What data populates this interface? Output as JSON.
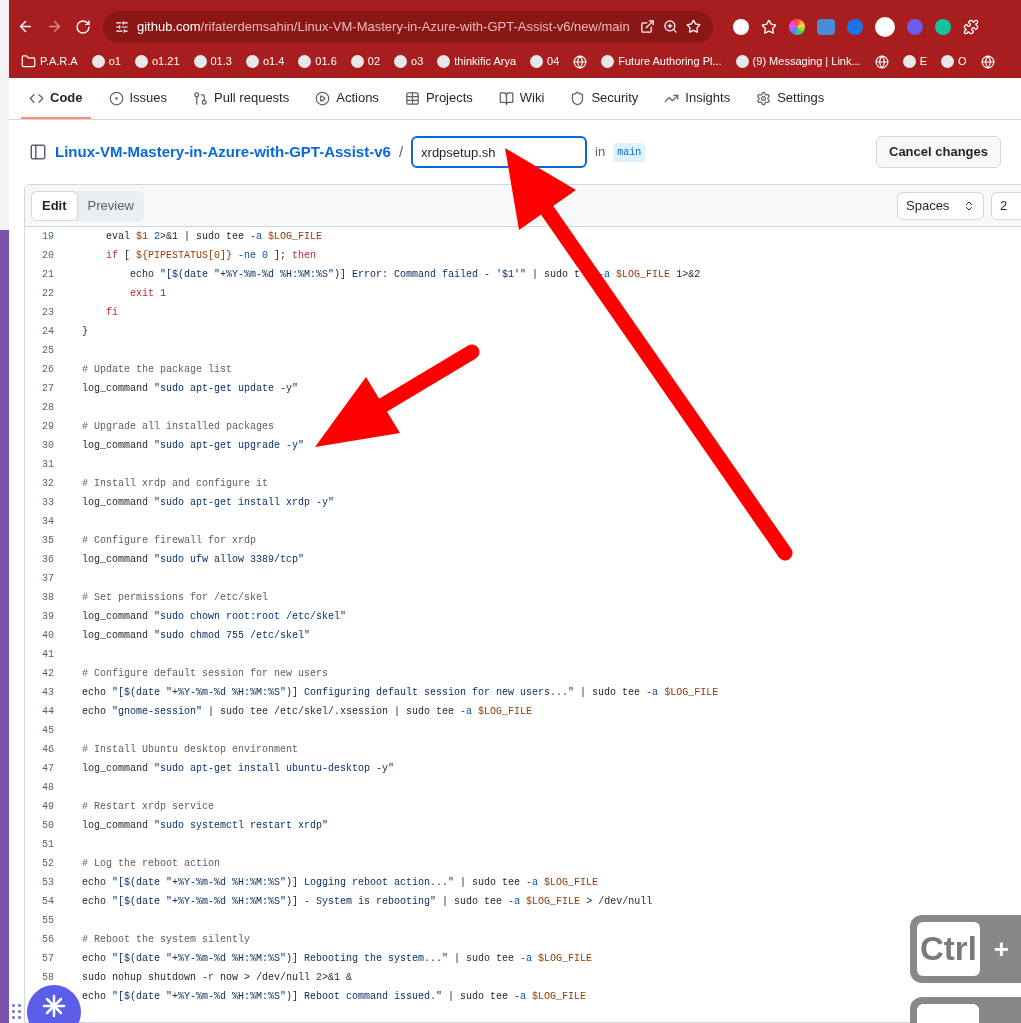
{
  "browser": {
    "url_host": "github.com",
    "url_path": "/rifaterdemsahin/Linux-VM-Mastery-in-Azure-with-GPT-Assist-v6/new/main",
    "bookmarks": [
      {
        "kind": "folder",
        "label": "P.A.R.A"
      },
      {
        "kind": "link",
        "label": "o1"
      },
      {
        "kind": "link",
        "label": "o1.21"
      },
      {
        "kind": "link",
        "label": "01.3"
      },
      {
        "kind": "link",
        "label": "o1.4"
      },
      {
        "kind": "link",
        "label": "01.6"
      },
      {
        "kind": "link",
        "label": "02"
      },
      {
        "kind": "link",
        "label": "o3"
      },
      {
        "kind": "link",
        "label": "thinkific Arya"
      },
      {
        "kind": "link",
        "label": "04"
      },
      {
        "kind": "icon"
      },
      {
        "kind": "link",
        "label": "Future Authoring Pl..."
      },
      {
        "kind": "link",
        "label": "(9) Messaging | Link..."
      },
      {
        "kind": "icon"
      },
      {
        "kind": "link",
        "label": "E"
      },
      {
        "kind": "link",
        "label": "O"
      },
      {
        "kind": "icon"
      }
    ]
  },
  "repo_nav": [
    {
      "label": "Code",
      "selected": true
    },
    {
      "label": "Issues",
      "selected": false
    },
    {
      "label": "Pull requests",
      "selected": false
    },
    {
      "label": "Actions",
      "selected": false
    },
    {
      "label": "Projects",
      "selected": false
    },
    {
      "label": "Wiki",
      "selected": false
    },
    {
      "label": "Security",
      "selected": false
    },
    {
      "label": "Insights",
      "selected": false
    },
    {
      "label": "Settings",
      "selected": false
    }
  ],
  "breadcrumb": {
    "repo": "Linux-VM-Mastery-in-Azure-with-GPT-Assist-v6",
    "separator": "/",
    "filename": "xrdpsetup.sh",
    "in_label": "in",
    "branch": "main",
    "cancel_button": "Cancel changes"
  },
  "editor": {
    "modes": [
      {
        "label": "Edit",
        "selected": true
      },
      {
        "label": "Preview",
        "selected": false
      }
    ],
    "indent_mode": "Spaces",
    "indent_size": "2",
    "lines": [
      {
        "number": "19",
        "tokens": [
          {
            "kind": "plain",
            "text": "    eval "
          },
          {
            "kind": "var",
            "text": "$1"
          },
          {
            "kind": "num",
            "text": " 2"
          },
          {
            "kind": "plain",
            "text": ">&1 | sudo tee "
          },
          {
            "kind": "flag",
            "text": "-a "
          },
          {
            "kind": "var",
            "text": "$LOG_FILE"
          }
        ]
      },
      {
        "number": "20",
        "tokens": [
          {
            "kind": "kw",
            "text": "    if"
          },
          {
            "kind": "plain",
            "text": " [ "
          },
          {
            "kind": "var",
            "text": "${PIPESTATUS[0]}"
          },
          {
            "kind": "flag",
            "text": " -ne "
          },
          {
            "kind": "num",
            "text": "0"
          },
          {
            "kind": "plain",
            "text": " ]; "
          },
          {
            "kind": "kw",
            "text": "then"
          }
        ]
      },
      {
        "number": "21",
        "tokens": [
          {
            "kind": "plain",
            "text": "        echo "
          },
          {
            "kind": "str",
            "text": "\"[$(date \"+%Y-%m-%d %H:%M:%S\")] Error: Command failed - '$1'\""
          },
          {
            "kind": "plain",
            "text": " | sudo t"
          },
          {
            "kind": "covered"
          },
          {
            "kind": "flag",
            "text": "-a "
          },
          {
            "kind": "var",
            "text": "$LOG_FILE"
          },
          {
            "kind": "plain",
            "text": " 1>&2"
          }
        ]
      },
      {
        "number": "22",
        "tokens": [
          {
            "kind": "kw",
            "text": "        exit"
          },
          {
            "kind": "num",
            "text": " 1"
          }
        ]
      },
      {
        "number": "23",
        "tokens": [
          {
            "kind": "kw",
            "text": "    fi"
          }
        ]
      },
      {
        "number": "24",
        "tokens": [
          {
            "kind": "plain",
            "text": "}"
          }
        ]
      },
      {
        "number": "25"
      },
      {
        "number": "26",
        "tokens": [
          {
            "kind": "comment",
            "text": "# Update the package list"
          }
        ]
      },
      {
        "number": "27",
        "tokens": [
          {
            "kind": "plain",
            "text": "log_command "
          },
          {
            "kind": "str",
            "text": "\"sudo apt-get update -y\""
          }
        ]
      },
      {
        "number": "28"
      },
      {
        "number": "29",
        "tokens": [
          {
            "kind": "comment",
            "text": "# Upgrade all installed packages"
          }
        ]
      },
      {
        "number": "30",
        "tokens": [
          {
            "kind": "plain",
            "text": "log_command "
          },
          {
            "kind": "str",
            "text": "\"sudo apt-get upgrade -y\""
          }
        ]
      },
      {
        "number": "31"
      },
      {
        "number": "32",
        "tokens": [
          {
            "kind": "comment",
            "text": "# Install xrdp and configure it"
          }
        ]
      },
      {
        "number": "33",
        "tokens": [
          {
            "kind": "plain",
            "text": "log_command "
          },
          {
            "kind": "str",
            "text": "\"sudo apt-get install xrdp -y\""
          }
        ]
      },
      {
        "number": "34"
      },
      {
        "number": "35",
        "tokens": [
          {
            "kind": "comment",
            "text": "# Configure firewall for xrdp"
          }
        ]
      },
      {
        "number": "36",
        "tokens": [
          {
            "kind": "plain",
            "text": "log_command "
          },
          {
            "kind": "str",
            "text": "\"sudo ufw allow 3389/tcp\""
          }
        ]
      },
      {
        "number": "37"
      },
      {
        "number": "38",
        "tokens": [
          {
            "kind": "comment",
            "text": "# Set permissions for /etc/skel"
          }
        ]
      },
      {
        "number": "39",
        "tokens": [
          {
            "kind": "plain",
            "text": "log_command "
          },
          {
            "kind": "str",
            "text": "\"sudo chown root:root /etc/skel\""
          }
        ]
      },
      {
        "number": "40",
        "tokens": [
          {
            "kind": "plain",
            "text": "log_command "
          },
          {
            "kind": "str",
            "text": "\"sudo chmod 755 /etc/skel\""
          }
        ]
      },
      {
        "number": "41"
      },
      {
        "number": "42",
        "tokens": [
          {
            "kind": "comment",
            "text": "# Configure default session for new users"
          }
        ]
      },
      {
        "number": "43",
        "tokens": [
          {
            "kind": "plain",
            "text": "echo "
          },
          {
            "kind": "str",
            "text": "\"[$(date \"+%Y-%m-%d %H:%M:%S\")] Configuring default session for new users...\""
          },
          {
            "kind": "plain",
            "text": " | sudo tee "
          },
          {
            "kind": "flag",
            "text": "-a "
          },
          {
            "kind": "var",
            "text": "$LOG_FILE"
          }
        ]
      },
      {
        "number": "44",
        "tokens": [
          {
            "kind": "plain",
            "text": "echo "
          },
          {
            "kind": "str",
            "text": "\"gnome-session\""
          },
          {
            "kind": "plain",
            "text": " | sudo tee /etc/skel/.xsession | sudo tee "
          },
          {
            "kind": "flag",
            "text": "-a "
          },
          {
            "kind": "var",
            "text": "$LOG_FILE"
          }
        ]
      },
      {
        "number": "45"
      },
      {
        "number": "46",
        "tokens": [
          {
            "kind": "comment",
            "text": "# Install Ubuntu desktop environment"
          }
        ]
      },
      {
        "number": "47",
        "tokens": [
          {
            "kind": "plain",
            "text": "log_command "
          },
          {
            "kind": "str",
            "text": "\"sudo apt-get install ubuntu-desktop -y\""
          }
        ]
      },
      {
        "number": "48"
      },
      {
        "number": "49",
        "tokens": [
          {
            "kind": "comment",
            "text": "# Restart xrdp service"
          }
        ]
      },
      {
        "number": "50",
        "tokens": [
          {
            "kind": "plain",
            "text": "log_command "
          },
          {
            "kind": "str",
            "text": "\"sudo systemctl restart xrdp\""
          }
        ]
      },
      {
        "number": "51"
      },
      {
        "number": "52",
        "tokens": [
          {
            "kind": "comment",
            "text": "# Log the reboot action"
          }
        ]
      },
      {
        "number": "53",
        "tokens": [
          {
            "kind": "plain",
            "text": "echo "
          },
          {
            "kind": "str",
            "text": "\"[$(date \"+%Y-%m-%d %H:%M:%S\")] Logging reboot action...\""
          },
          {
            "kind": "plain",
            "text": " | sudo tee "
          },
          {
            "kind": "flag",
            "text": "-a "
          },
          {
            "kind": "var",
            "text": "$LOG_FILE"
          }
        ]
      },
      {
        "number": "54",
        "tokens": [
          {
            "kind": "plain",
            "text": "echo "
          },
          {
            "kind": "str",
            "text": "\"[$(date \"+%Y-%m-%d %H:%M:%S\")] - System is rebooting\""
          },
          {
            "kind": "plain",
            "text": " | sudo tee "
          },
          {
            "kind": "flag",
            "text": "-a "
          },
          {
            "kind": "var",
            "text": "$LOG_FILE"
          },
          {
            "kind": "plain",
            "text": " > /dev/null"
          }
        ]
      },
      {
        "number": "55"
      },
      {
        "number": "56",
        "tokens": [
          {
            "kind": "comment",
            "text": "# Reboot the system silently"
          }
        ]
      },
      {
        "number": "57",
        "tokens": [
          {
            "kind": "plain",
            "text": "echo "
          },
          {
            "kind": "str",
            "text": "\"[$(date \"+%Y-%m-%d %H:%M:%S\")] Rebooting the system...\""
          },
          {
            "kind": "plain",
            "text": " | sudo tee "
          },
          {
            "kind": "flag",
            "text": "-a "
          },
          {
            "kind": "var",
            "text": "$LOG_FILE"
          }
        ]
      },
      {
        "number": "58",
        "tokens": [
          {
            "kind": "plain",
            "text": "sudo nohup shutdown "
          },
          {
            "kind": "flag",
            "text": "-r"
          },
          {
            "kind": "plain",
            "text": " now > /dev/null "
          },
          {
            "kind": "num",
            "text": "2"
          },
          {
            "kind": "plain",
            "text": ">&1 &"
          }
        ]
      },
      {
        "tokens": [
          {
            "kind": "plain",
            "text": "echo "
          },
          {
            "kind": "str",
            "text": "\"[$(date \"+%Y-%m-%d %H:%M:%S\")] Reboot command issued.\""
          },
          {
            "kind": "plain",
            "text": " | sudo tee "
          },
          {
            "kind": "flag",
            "text": "-a "
          },
          {
            "kind": "var",
            "text": "$LOG_FILE"
          }
        ]
      }
    ]
  },
  "key_overlay": {
    "key": "Ctrl",
    "plus": "+"
  }
}
